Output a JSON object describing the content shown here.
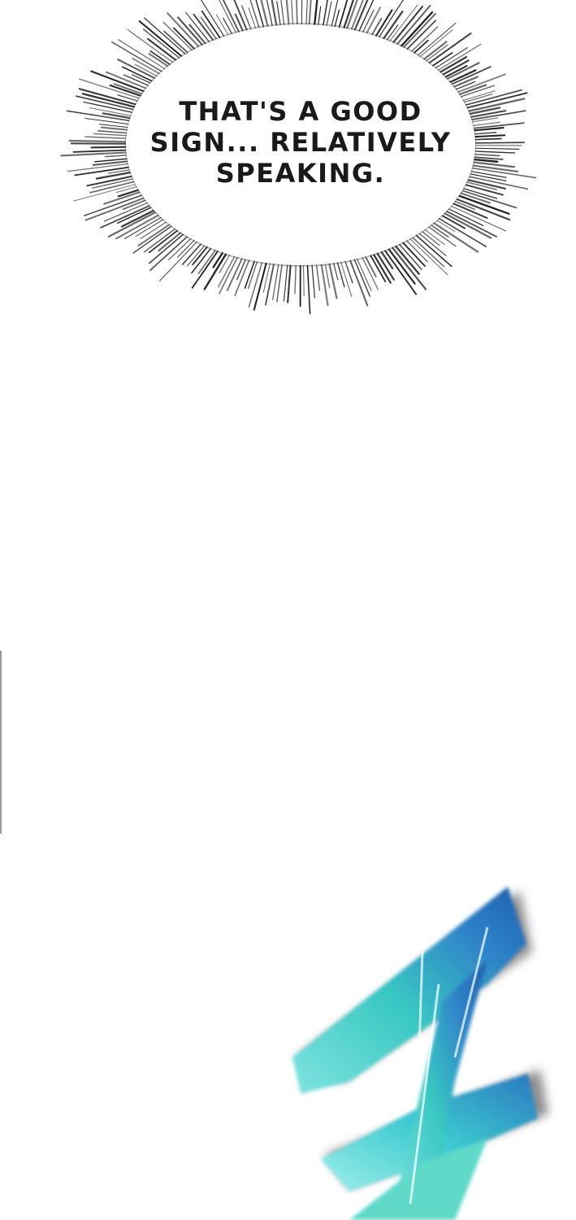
{
  "panel": {
    "background": "#ffffff",
    "speech_bubble": {
      "style": "emphasis-burst",
      "lines": [
        "THAT'S A GOOD",
        "SIGN... RELATIVELY",
        "SPEAKING."
      ]
    },
    "motion_art": {
      "description_icon": "blue-motion-blur-figure",
      "colors": [
        "#1f5fae",
        "#2f86c9",
        "#38c7c2",
        "#7fe3e0"
      ]
    }
  }
}
